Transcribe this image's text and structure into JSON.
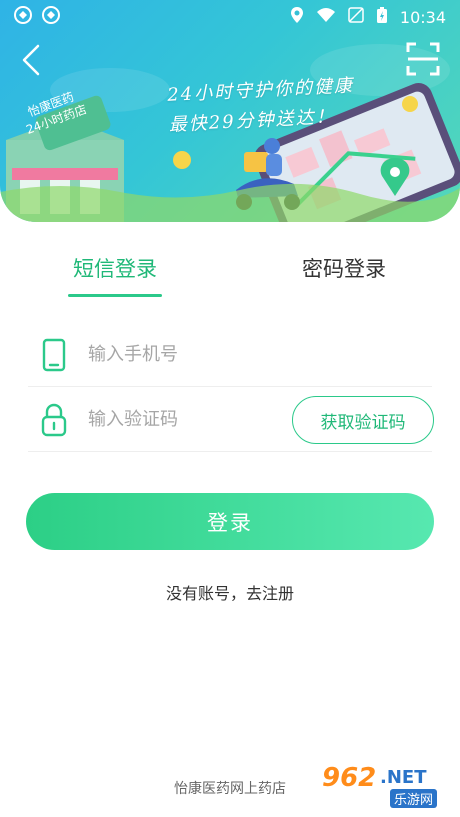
{
  "status_bar": {
    "time": "10:34"
  },
  "banner": {
    "slogan_line1": "24小时守护你的健康",
    "slogan_line2": "最快29分钟送达！",
    "store_sign_line1": "怡康医药",
    "store_sign_line2": "24小时药店"
  },
  "tabs": [
    {
      "label": "短信登录",
      "active": true
    },
    {
      "label": "密码登录",
      "active": false
    }
  ],
  "phone_field": {
    "placeholder": "输入手机号"
  },
  "code_field": {
    "placeholder": "输入验证码"
  },
  "get_code_label": "获取验证码",
  "login_label": "登录",
  "register_link": "没有账号，去注册",
  "footer": "怡康医药网上药店",
  "watermark": {
    "number": "962",
    "net": ".NET",
    "site": "乐游网"
  },
  "colors": {
    "accent": "#2bc98a",
    "accent_text": "#20b878",
    "banner_start": "#2fb3e6",
    "banner_end": "#55d8b8"
  }
}
